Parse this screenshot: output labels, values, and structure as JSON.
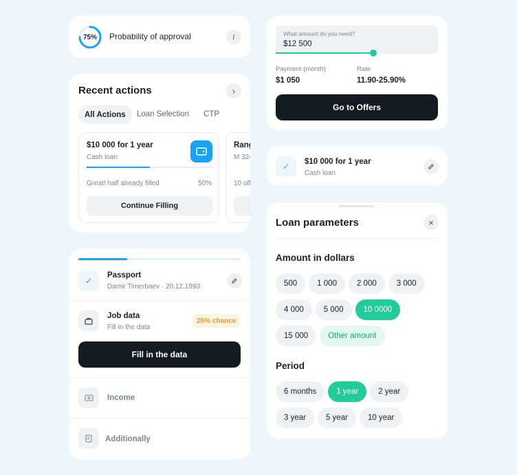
{
  "approval": {
    "percent": "75%",
    "percent_value": 75,
    "label": "Probability of approval"
  },
  "recent": {
    "title": "Recent actions",
    "tabs": [
      "All Actions",
      "Loan Selection",
      "CTP"
    ],
    "card1": {
      "title": "$10 000 for 1 year",
      "subtitle": "Cash loan",
      "progress_text": "Great! half already filled",
      "progress_pct": "50%",
      "progress_value": 50,
      "button": "Continue Filling"
    },
    "card2": {
      "title": "Rang",
      "subtitle": "M 324",
      "progress_text": "10 off"
    }
  },
  "steps": {
    "progress_value": 30,
    "passport": {
      "title": "Passport",
      "subtitle": "Damir Timerbaev · 20.12.1993"
    },
    "job": {
      "title": "Job data",
      "subtitle": "Fill in the data",
      "badge": "25% chance"
    },
    "fill_button": "Fill in the data",
    "income": {
      "title": "Income"
    },
    "additionally": {
      "title": "Additionally"
    }
  },
  "amount_form": {
    "label": "What amount do you need?",
    "value": "$12 500",
    "slider_value": 60,
    "payment_label": "Payment (month)",
    "payment_value": "$1 050",
    "rate_label": "Rate",
    "rate_value": "11.90-25.90%",
    "button": "Go to Offers"
  },
  "selected_loan": {
    "title": "$10 000 for 1 year",
    "subtitle": "Cash loan"
  },
  "loan_params": {
    "title": "Loan parameters",
    "amount_title": "Amount in dollars",
    "amounts": [
      {
        "label": "500",
        "state": "normal"
      },
      {
        "label": "1 000",
        "state": "normal"
      },
      {
        "label": "2 000",
        "state": "normal"
      },
      {
        "label": "3 000",
        "state": "normal"
      },
      {
        "label": "4 000",
        "state": "normal"
      },
      {
        "label": "5 000",
        "state": "normal"
      },
      {
        "label": "10 0000",
        "state": "active"
      },
      {
        "label": "15 000",
        "state": "normal"
      },
      {
        "label": "Other amount",
        "state": "other"
      }
    ],
    "period_title": "Period",
    "periods": [
      {
        "label": "6 months",
        "state": "normal"
      },
      {
        "label": "1 year",
        "state": "active"
      },
      {
        "label": "2 year",
        "state": "normal"
      },
      {
        "label": "3 year",
        "state": "normal"
      },
      {
        "label": "5 year",
        "state": "normal"
      },
      {
        "label": "10 year",
        "state": "normal"
      }
    ]
  },
  "colors": {
    "accent": "#1fcc9a",
    "blue": "#1aa3f5",
    "dark": "#141b21",
    "background": "#eef6fd"
  }
}
